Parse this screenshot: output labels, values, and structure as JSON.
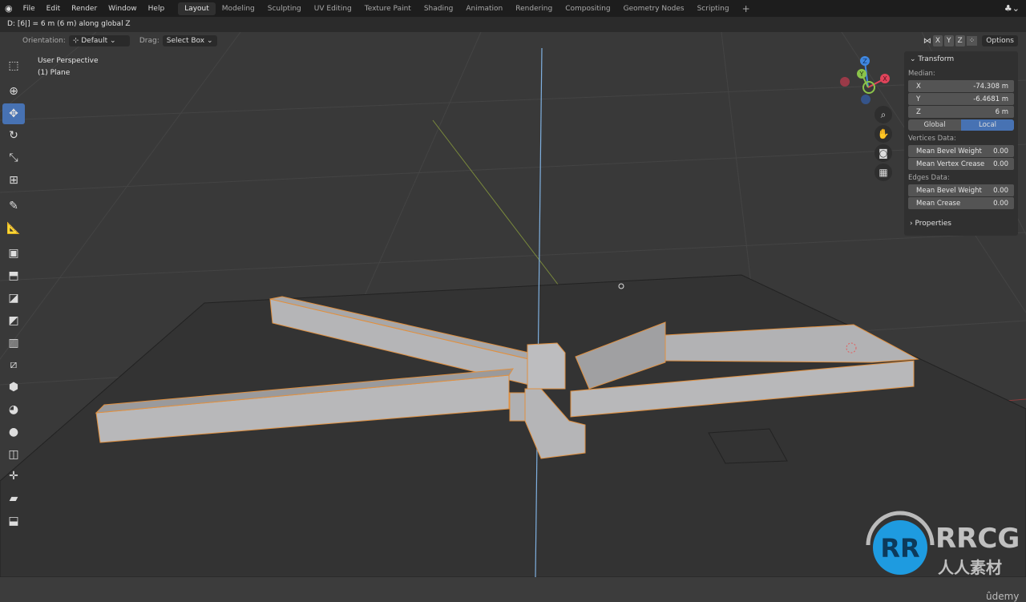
{
  "topbar": {
    "menus": [
      "File",
      "Edit",
      "Render",
      "Window",
      "Help"
    ],
    "workspaces": [
      "Layout",
      "Modeling",
      "Sculpting",
      "UV Editing",
      "Texture Paint",
      "Shading",
      "Animation",
      "Rendering",
      "Compositing",
      "Geometry Nodes",
      "Scripting"
    ],
    "active_workspace": "Layout",
    "add_tab": "+"
  },
  "status": "D: [6|] = 6 m (6 m) along global Z",
  "header": {
    "orientation_label": "Orientation:",
    "orientation_value": "Default",
    "drag_label": "Drag:",
    "drag_value": "Select Box",
    "axes": [
      "X",
      "Y",
      "Z"
    ],
    "options": "Options"
  },
  "viewport": {
    "perspective": "User Perspective",
    "object": "(1) Plane"
  },
  "tools": [
    "select-box-icon",
    "cursor-icon",
    "move-icon",
    "rotate-icon",
    "scale-icon",
    "transform-icon",
    "annotate-icon",
    "measure-icon",
    "add-cube-icon",
    "extrude-icon",
    "inset-icon",
    "bevel-icon",
    "loop-cut-icon",
    "knife-icon",
    "poly-build-icon",
    "spin-icon",
    "smooth-icon",
    "edge-slide-icon",
    "shrink-fatten-icon",
    "shear-icon",
    "rip-region-icon"
  ],
  "active_tool": 2,
  "transform": {
    "title": "Transform",
    "median": "Median:",
    "x_label": "X",
    "x": "-74.308 m",
    "y_label": "Y",
    "y": "-6.4681 m",
    "z_label": "Z",
    "z": "6 m",
    "global": "Global",
    "local": "Local",
    "vertices_data": "Vertices Data:",
    "v_bevel_label": "Mean Bevel Weight",
    "v_bevel": "0.00",
    "v_crease_label": "Mean Vertex Crease",
    "v_crease": "0.00",
    "edges_data": "Edges Data:",
    "e_bevel_label": "Mean Bevel Weight",
    "e_bevel": "0.00",
    "e_crease_label": "Mean Crease",
    "e_crease": "0.00",
    "properties": "Properties"
  },
  "gizmo": {
    "x": "X",
    "y": "Y",
    "z": "Z",
    "x_color": "#e0445a",
    "y_color": "#8bc34a",
    "z_color": "#3f87e0"
  },
  "watermark": {
    "brand": "RRCG",
    "sub": "人人素材",
    "udemy": "ûdemy",
    "color": "#1e9be0"
  }
}
